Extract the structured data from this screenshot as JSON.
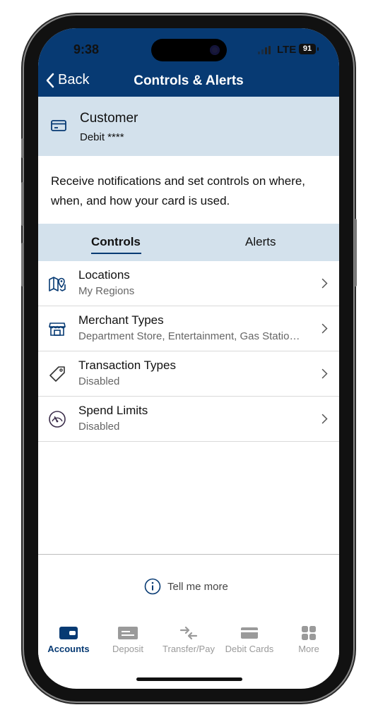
{
  "status_bar": {
    "time": "9:38",
    "network": "LTE",
    "battery": "91"
  },
  "nav": {
    "back_label": "Back",
    "title": "Controls & Alerts"
  },
  "customer": {
    "name": "Customer",
    "account": "Debit ****"
  },
  "description": "Receive notifications and set controls on where, when, and how your card is used.",
  "tabs": [
    {
      "label": "Controls",
      "active": true
    },
    {
      "label": "Alerts",
      "active": false
    }
  ],
  "controls": [
    {
      "label": "Locations",
      "sub": "My Regions",
      "icon": "map-pin-icon"
    },
    {
      "label": "Merchant Types",
      "sub": "Department Store, Entertainment, Gas Statio…",
      "icon": "store-icon"
    },
    {
      "label": "Transaction Types",
      "sub": "Disabled",
      "icon": "tag-icon"
    },
    {
      "label": "Spend Limits",
      "sub": "Disabled",
      "icon": "gauge-icon"
    }
  ],
  "tell_more": "Tell me more",
  "tab_bar": [
    {
      "label": "Accounts",
      "icon": "wallet-icon",
      "active": true
    },
    {
      "label": "Deposit",
      "icon": "check-deposit-icon",
      "active": false
    },
    {
      "label": "Transfer/Pay",
      "icon": "transfer-arrows-icon",
      "active": false
    },
    {
      "label": "Debit Cards",
      "icon": "credit-card-icon",
      "active": false
    },
    {
      "label": "More",
      "icon": "grid-icon",
      "active": false
    }
  ],
  "colors": {
    "brand": "#073a73",
    "panel": "#d3e1ec",
    "inactive": "#9a9a9a"
  }
}
